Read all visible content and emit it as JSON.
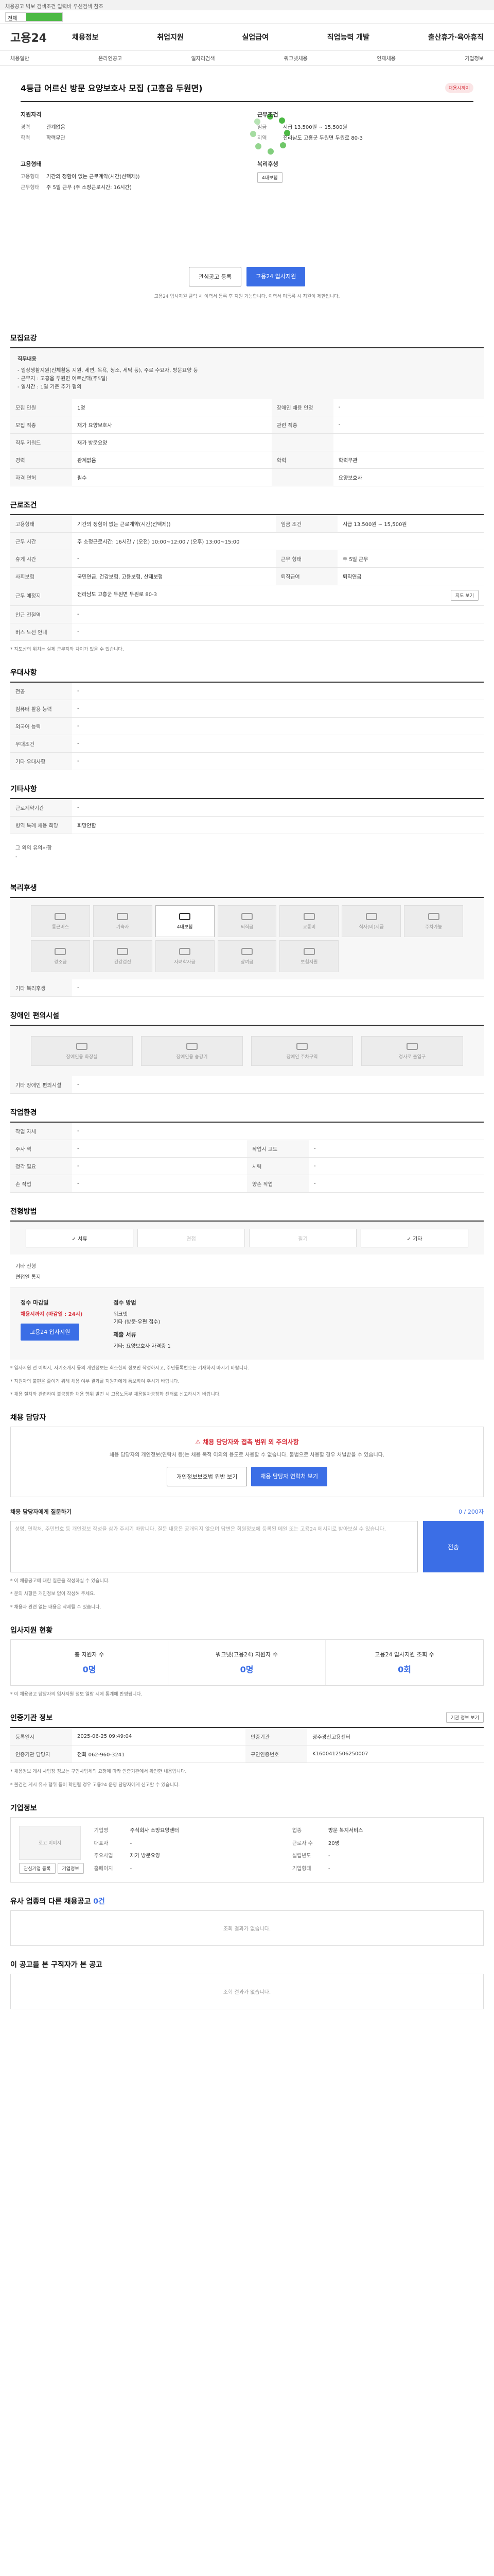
{
  "top_notice": "채용공고 벽보 검색조건 입력바 우선검색 참조",
  "search": {
    "scope": "전체",
    "query": ""
  },
  "logo": "고용24",
  "gnb": [
    "채용정보",
    "취업지원",
    "실업급여",
    "직업능력 개발",
    "출산휴가·육아휴직"
  ],
  "subnav": [
    "채용일반",
    "온라인공고",
    "일자리검색",
    "워크넷채용",
    "인재채용",
    "기업정보"
  ],
  "job": {
    "title": "4등급 어르신 방문 요양보호사 모집 (고흥읍 두원면)",
    "status": "채용시까지",
    "company_block": "지원자격",
    "company_rows": [
      {
        "k": "경력",
        "v": "관계없음"
      },
      {
        "k": "학력",
        "v": "학력무관"
      }
    ],
    "condition_block": "근무조건",
    "condition_rows": [
      {
        "k": "임금",
        "v": "시급 13,500원 ~ 15,500원"
      },
      {
        "k": "지역",
        "v": "전라남도 고흥군 두원면 두원로 80-3"
      }
    ],
    "type_block": "고용형태",
    "type_rows": [
      {
        "k": "고용형태",
        "v": "기간의 정함이 없는 근로계약(시간(선택제))"
      },
      {
        "k": "근무형태",
        "v": "주 5일 근무 (주 소정근로시간: 16시간)"
      }
    ],
    "welfare_block": "복리후생",
    "welfare_tag": "4대보험",
    "btn_interest": "관심공고 등록",
    "btn_apply": "고용24 입사지원",
    "hint": "고용24 입사지원 클릭 시 이력서 등록 후 지원 가능합니다. 이력서 미등록 시 지원이 제한됩니다."
  },
  "recruit": {
    "title": "모집요강",
    "duty_label": "직무내용",
    "duty": [
      "- 일상생활지원(신체활동 지원, 세면, 목욕, 청소, 세탁 등), 주로 수요자, 방문요양 등",
      "- 근무지 : 고흥읍 두원면 어르신댁(주5일)",
      "- 일시간 : 1일 기준 추가 협의"
    ],
    "rows": [
      {
        "k": "모집 인원",
        "v": "1명",
        "k2": "장애인 채용 인정",
        "v2": "-"
      },
      {
        "k": "모집 직종",
        "v": "재가 요양보호사",
        "k2": "관련 직종",
        "v2": "-"
      },
      {
        "k": "직무 키워드",
        "v": "재가 방문요양",
        "k2": "",
        "v2": ""
      },
      {
        "k": "경력",
        "v": "관계없음",
        "k2": "학력",
        "v2": "학력무관"
      },
      {
        "k": "자격 면허",
        "v": "필수",
        "k2": "",
        "v2": "요양보호사"
      }
    ]
  },
  "work": {
    "title": "근로조건",
    "rows": [
      {
        "k": "고용형태",
        "v": "기간의 정함이 없는 근로계약(시간(선택제))",
        "k2": "임금 조건",
        "v2": "시급 13,500원 ~ 15,500원"
      },
      {
        "k": "근무 시간",
        "v": "주 소정근로시간: 16시간 / (오전) 10:00~12:00 / (오후) 13:00~15:00"
      },
      {
        "k": "휴게 시간",
        "v": "-",
        "k2": "근무 형태",
        "v2": "주 5일 근무"
      },
      {
        "k": "사회보험",
        "v": "국민연금, 건강보험, 고용보험, 산재보험",
        "k2": "퇴직급여",
        "v2": "퇴직연금"
      },
      {
        "k": "근무 예정지",
        "v": "전라남도 고흥군 두원면 두원로 80-3"
      },
      {
        "k": "인근 전철역",
        "v": "-"
      },
      {
        "k": "버스 노선 안내",
        "v": "-"
      }
    ],
    "map_btn": "지도 보기",
    "note": "* 지도상의 위치는 실제 근무지와 차이가 있을 수 있습니다."
  },
  "prefer": {
    "title": "우대사항",
    "rows": [
      {
        "k": "전공",
        "v": "-"
      },
      {
        "k": "컴퓨터 활용 능력",
        "v": "-"
      },
      {
        "k": "외국어 능력",
        "v": "-"
      },
      {
        "k": "우대조건",
        "v": "-"
      },
      {
        "k": "기타 우대사항",
        "v": "-"
      }
    ]
  },
  "etc": {
    "title": "기타사항",
    "rows": [
      {
        "k": "근로계약기간",
        "v": "-"
      },
      {
        "k": "병역 특례 채용 희망",
        "v": "희망안함"
      }
    ],
    "more_label": "그 외의 유의사항",
    "more": "-"
  },
  "welfare": {
    "title": "복리후생",
    "items": [
      "통근버스",
      "기숙사",
      "4대보험",
      "퇴직금",
      "교통비",
      "식사(비)지급",
      "주차가능",
      "경조금",
      "건강검진",
      "자녀학자금",
      "상여금",
      "보험지원"
    ],
    "active": "4대보험",
    "etc_label": "기타 복리후생",
    "etc": "-"
  },
  "disability": {
    "title": "장애인 편의시설",
    "items": [
      "장애인용 화장실",
      "장애인용 승강기",
      "장애인 주차구역",
      "경사로 출입구"
    ],
    "etc_label": "기타 장애인 편의시설",
    "etc": "-"
  },
  "env": {
    "title": "작업환경",
    "rows": [
      {
        "k": "작업 자세",
        "v": "-"
      },
      {
        "k": "주사 역",
        "v": "-",
        "k2": "작업시 고도",
        "v2": "-"
      },
      {
        "k": "청각 필요",
        "v": "-",
        "k2": "시력",
        "v2": "-"
      },
      {
        "k": "손 작업",
        "v": "-",
        "k2": "양손 작업",
        "v2": "-"
      }
    ]
  },
  "method": {
    "title": "전형방법",
    "items": [
      "서류",
      "면접",
      "필기",
      "기타"
    ],
    "active": [
      "서류",
      "기타"
    ],
    "doc_label": "기타 전형",
    "doc": "면접일 통지"
  },
  "apply": {
    "title": "접수 마감일",
    "deadline": "채용시까지 (마감일 : 24시)",
    "method_label": "접수 방법",
    "methods": [
      "워크넷",
      "기타 (방문·우편 접수)"
    ],
    "doc_label": "제출 서류",
    "docs": "기타: 요양보호사 자격증 1",
    "btn": "고용24 입사지원",
    "notes": [
      "* 입사지원 전 이력서, 자기소개서 등의 개인정보는 최소한의 정보만 작성하시고, 주민등록번호는 기재하지 마시기 바랍니다.",
      "* 지원자의 불편을 줄이기 위해 채용 여부 결과를 지원자에게 통보하여 주시기 바랍니다.",
      "* 채용 절차와 관련하여 불공정한 채용 행위 발견 시 고용노동부 채용절차공정화 센터로 신고하시기 바랍니다."
    ]
  },
  "contact": {
    "title": "채용 담당자",
    "warn": "채용 담당자와 접촉 범위 외 주의사항",
    "body": "채용 담당자의 개인정보(연락처 등)는 채용 목적 이외의 용도로 사용할 수 없습니다. 불법으로 사용할 경우 처벌받을 수 있습니다.",
    "btn1": "개인정보보호법 위반 보기",
    "btn2": "채용 담당자 연락처 보기",
    "qa_title": "채용 담당자에게 질문하기",
    "qa_count": "0 / 200자",
    "qa_placeholder": "성명, 연락처, 주민번호 등 개인정보 작성을 삼가 주시기 바랍니다. 질문 내용은 공개되지 않으며 답변은 회원정보에 등록된 메일 또는 고용24 메시지로 받아보실 수 있습니다.",
    "qa_btn": "전송",
    "qa_notes": [
      "* 이 채용공고에 대한 질문을 작성하실 수 있습니다.",
      "* 문의 사항은 개인정보 없이 작성해 주세요.",
      "* 채용과 관련 없는 내용은 삭제될 수 있습니다."
    ]
  },
  "stats": {
    "title": "입사지원 현황",
    "items": [
      {
        "label": "총 지원자 수",
        "value": "0명"
      },
      {
        "label": "워크넷(고용24) 지원자 수",
        "value": "0명"
      },
      {
        "label": "고용24 입사지원 조회 수",
        "value": "0회"
      }
    ],
    "note": "* 이 채용공고 담당자의 입사지원 정보 열람 시에 통계에 반영됩니다."
  },
  "info": {
    "title": "인증기관 정보",
    "btn": "기관 정보 보기",
    "rows": [
      {
        "k": "등록일시",
        "v": "2025-06-25 09:49:04",
        "k2": "인증기관",
        "v2": "광주광산고용센터"
      },
      {
        "k": "인증기관 담당자",
        "v": "전화 062-960-3241",
        "k2": "구인인증번호",
        "v2": "K1600412506250007"
      }
    ],
    "notes": [
      "* 채용정보 게시 사업장 정보는 구인사업체의 요청에 따라 인증기관에서 확인한 내용입니다.",
      "* 불건전 게시 유사 행위 등이 확인될 경우 고용24 운영 담당자에게 신고할 수 있습니다."
    ]
  },
  "company": {
    "title": "기업정보",
    "logo": "로고 이미지",
    "btn1": "관심기업 등록",
    "btn2": "기업정보",
    "rows": [
      {
        "k": "기업명",
        "v": "주식회사 소망요양센터",
        "k2": "업종",
        "v2": "방문 복지서비스"
      },
      {
        "k": "대표자",
        "v": "-",
        "k2": "근로자 수",
        "v2": "20명"
      },
      {
        "k": "주요사업",
        "v": "재가 방문요양",
        "k2": "설립년도",
        "v2": "-"
      },
      {
        "k": "홈페이지",
        "v": "-",
        "k2": "기업형태",
        "v2": "-"
      }
    ]
  },
  "similar": {
    "title": "유사 업종의 다른 채용공고",
    "count": "0건",
    "empty": "조회 결과가 없습니다."
  },
  "recommend": {
    "title": "이 공고를 본 구직자가 본 공고",
    "empty": "조회 결과가 없습니다."
  }
}
